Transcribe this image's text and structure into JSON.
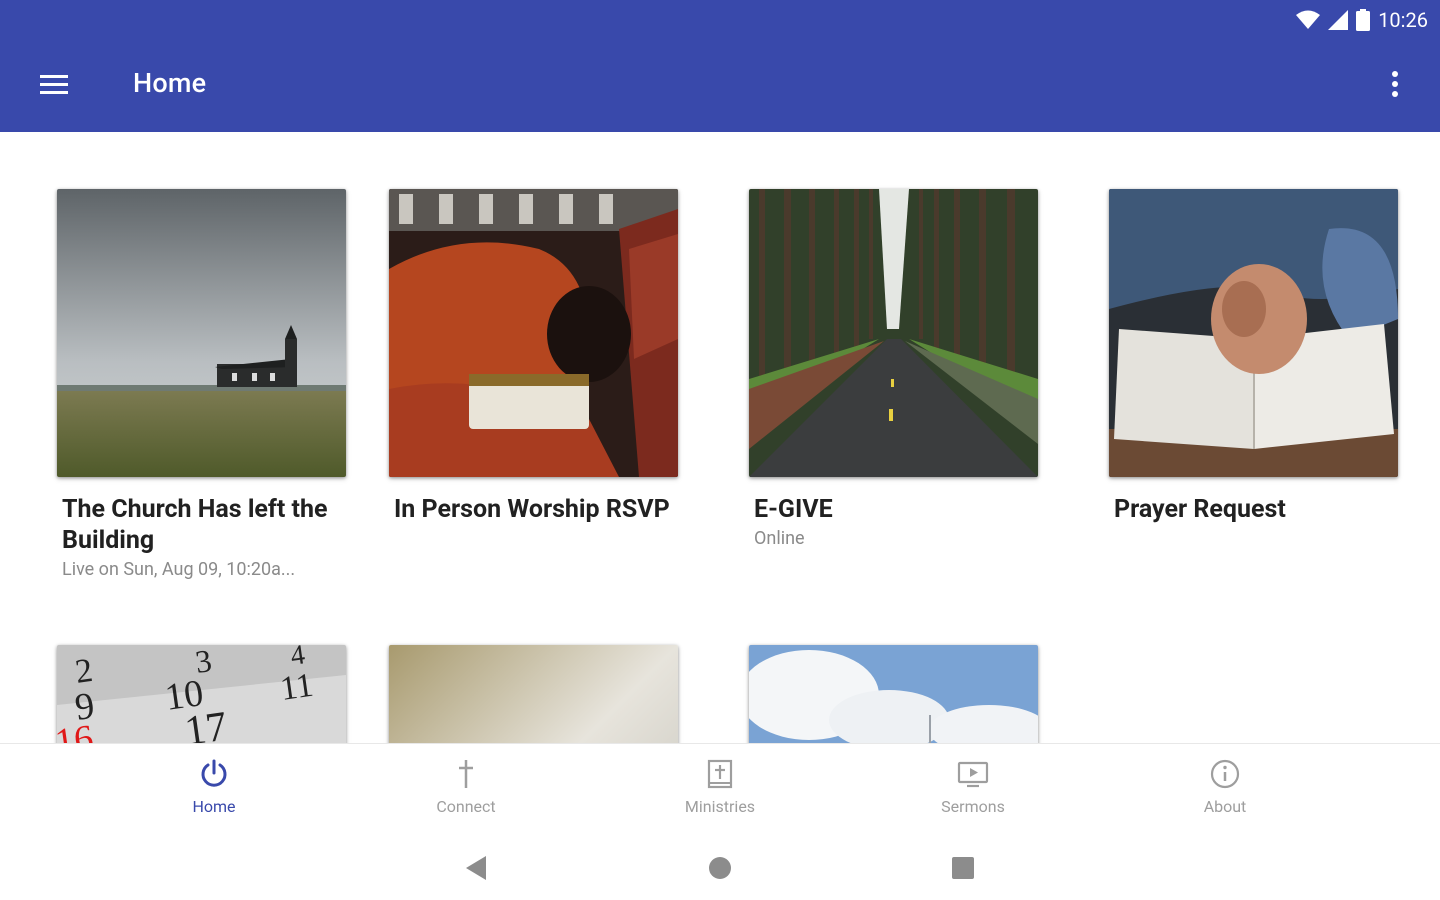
{
  "status_bar": {
    "time": "10:26"
  },
  "app_bar": {
    "title": "Home",
    "menu_icon": "hamburger-icon",
    "more_icon": "more-vert-icon",
    "color": "#3949ab"
  },
  "cards": [
    {
      "title": "The Church Has left the Building",
      "subtitle": "Live on Sun, Aug 09, 10:20a..."
    },
    {
      "title": "In Person Worship RSVP",
      "subtitle": ""
    },
    {
      "title": "E-GIVE",
      "subtitle": "Online"
    },
    {
      "title": "Prayer Request",
      "subtitle": ""
    }
  ],
  "bottom_nav": [
    {
      "label": "Home",
      "icon": "power-icon",
      "active": true
    },
    {
      "label": "Connect",
      "icon": "cross-icon",
      "active": false
    },
    {
      "label": "Ministries",
      "icon": "book-cross-icon",
      "active": false
    },
    {
      "label": "Sermons",
      "icon": "video-icon",
      "active": false
    },
    {
      "label": "About",
      "icon": "info-icon",
      "active": false
    }
  ],
  "colors": {
    "accent": "#3949ab",
    "inactive": "#9e9e9e"
  }
}
